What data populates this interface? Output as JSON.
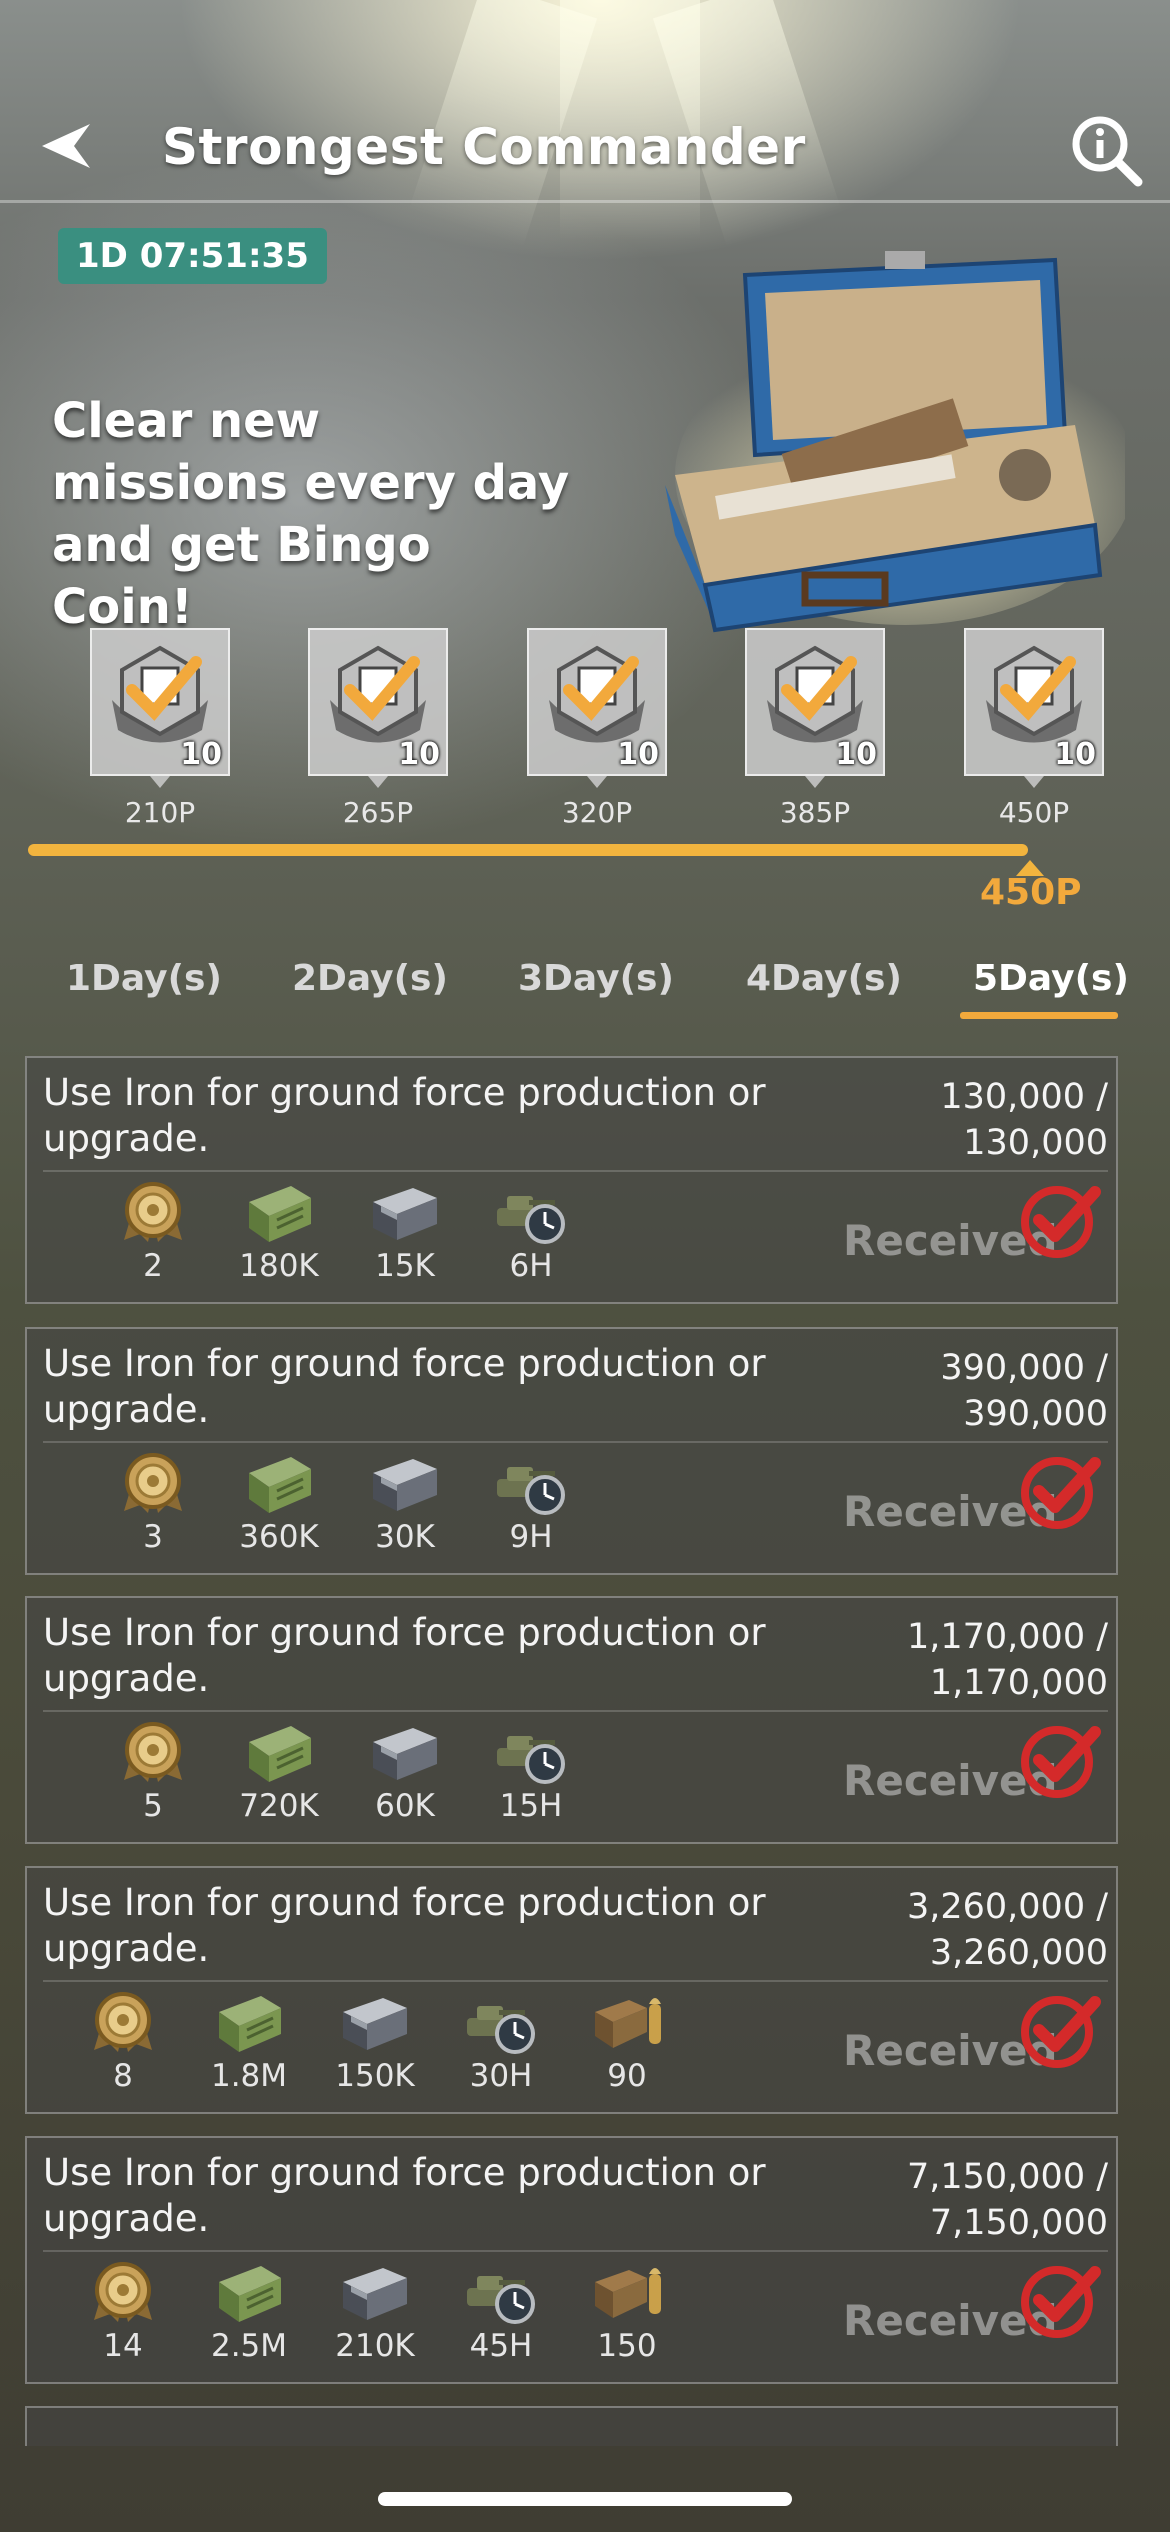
{
  "header": {
    "title": "Strongest Commander"
  },
  "timer": "1D 07:51:35",
  "headline": "Clear new missions every day and get Bingo Coin!",
  "milestones": [
    {
      "qty": "10",
      "points": "210P"
    },
    {
      "qty": "10",
      "points": "265P"
    },
    {
      "qty": "10",
      "points": "320P"
    },
    {
      "qty": "10",
      "points": "385P"
    },
    {
      "qty": "10",
      "points": "450P"
    }
  ],
  "progress": {
    "current_points": "450P",
    "fraction": 1.0
  },
  "tabs": [
    {
      "label": "1Day(s)"
    },
    {
      "label": "2Day(s)"
    },
    {
      "label": "3Day(s)"
    },
    {
      "label": "4Day(s)"
    },
    {
      "label": "5Day(s)",
      "active": true
    }
  ],
  "missions": [
    {
      "desc": "Use Iron for ground force production or upgrade.",
      "progress_line1": "130,000 /",
      "progress_line2": "130,000",
      "status": "Received",
      "rewards": [
        {
          "icon": "medal-coin-icon",
          "value": "2"
        },
        {
          "icon": "supply-crate-icon",
          "value": "180K"
        },
        {
          "icon": "iron-ingot-icon",
          "value": "15K"
        },
        {
          "icon": "speedup-tank-clock-icon",
          "value": "6H"
        }
      ]
    },
    {
      "desc": "Use Iron for ground force production or upgrade.",
      "progress_line1": "390,000 /",
      "progress_line2": "390,000",
      "status": "Received",
      "rewards": [
        {
          "icon": "medal-coin-icon",
          "value": "3"
        },
        {
          "icon": "supply-crate-icon",
          "value": "360K"
        },
        {
          "icon": "iron-ingot-icon",
          "value": "30K"
        },
        {
          "icon": "speedup-tank-clock-icon",
          "value": "9H"
        }
      ]
    },
    {
      "desc": "Use Iron for ground force production or upgrade.",
      "progress_line1": "1,170,000 /",
      "progress_line2": "1,170,000",
      "status": "Received",
      "rewards": [
        {
          "icon": "medal-coin-icon",
          "value": "5"
        },
        {
          "icon": "supply-crate-icon",
          "value": "720K"
        },
        {
          "icon": "iron-ingot-icon",
          "value": "60K"
        },
        {
          "icon": "speedup-tank-clock-icon",
          "value": "15H"
        }
      ]
    },
    {
      "desc": "Use Iron for ground force production or upgrade.",
      "progress_line1": "3,260,000 /",
      "progress_line2": "3,260,000",
      "status": "Received",
      "rewards": [
        {
          "icon": "medal-coin-icon",
          "value": "8"
        },
        {
          "icon": "supply-crate-icon",
          "value": "1.8M"
        },
        {
          "icon": "iron-ingot-icon",
          "value": "150K"
        },
        {
          "icon": "speedup-tank-clock-icon",
          "value": "30H"
        },
        {
          "icon": "ammo-box-icon",
          "value": "90"
        }
      ]
    },
    {
      "desc": "Use Iron for ground force production or upgrade.",
      "progress_line1": "7,150,000 /",
      "progress_line2": "7,150,000",
      "status": "Received",
      "rewards": [
        {
          "icon": "medal-coin-icon",
          "value": "14"
        },
        {
          "icon": "supply-crate-icon",
          "value": "2.5M"
        },
        {
          "icon": "iron-ingot-icon",
          "value": "210K"
        },
        {
          "icon": "speedup-tank-clock-icon",
          "value": "45H"
        },
        {
          "icon": "ammo-box-icon",
          "value": "150"
        }
      ]
    }
  ],
  "colors": {
    "accent": "#f2a93c",
    "timer_bg": "#3a8f80",
    "check_red": "#d42a2a"
  }
}
